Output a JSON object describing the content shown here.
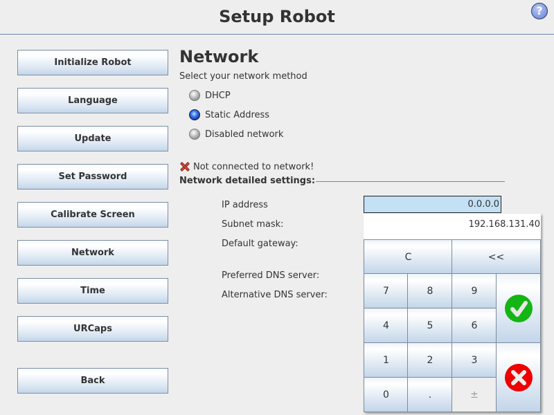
{
  "header": {
    "title": "Setup Robot",
    "help_icon": "question-mark-icon",
    "help_glyph": "?"
  },
  "sidebar": {
    "items": [
      {
        "label": "Initialize Robot"
      },
      {
        "label": "Language"
      },
      {
        "label": "Update"
      },
      {
        "label": "Set Password"
      },
      {
        "label": "Calibrate Screen"
      },
      {
        "label": "Network"
      },
      {
        "label": "Time"
      },
      {
        "label": "URCaps"
      }
    ],
    "back_label": "Back"
  },
  "network": {
    "title": "Network",
    "subtitle": "Select your network method",
    "methods": [
      {
        "label": "DHCP",
        "selected": false
      },
      {
        "label": "Static Address",
        "selected": true
      },
      {
        "label": "Disabled network",
        "selected": false
      }
    ],
    "status_icon": "error-x-icon",
    "status_text": "Not connected to network!",
    "details_title": "Network detailed settings:",
    "fields": [
      {
        "label": "IP address",
        "value": "0.0.0.0"
      },
      {
        "label": "Subnet mask:",
        "value": ""
      },
      {
        "label": "Default gateway:",
        "value": ""
      },
      {
        "label": "Preferred DNS server:",
        "value": ""
      },
      {
        "label": "Alternative DNS server:",
        "value": ""
      }
    ]
  },
  "keypad": {
    "display_value": "192.168.131.40",
    "clear_label": "C",
    "backspace_label": "<<",
    "digits": [
      "7",
      "8",
      "9",
      "4",
      "5",
      "6",
      "1",
      "2",
      "3",
      "0",
      "."
    ],
    "plus_minus_label": "±",
    "plus_minus_enabled": false,
    "ok_icon": "checkmark-icon",
    "cancel_icon": "cancel-x-icon",
    "colors": {
      "ok": "#14b514",
      "cancel": "#ee0000",
      "input_highlight": "#c3e0f4"
    }
  }
}
